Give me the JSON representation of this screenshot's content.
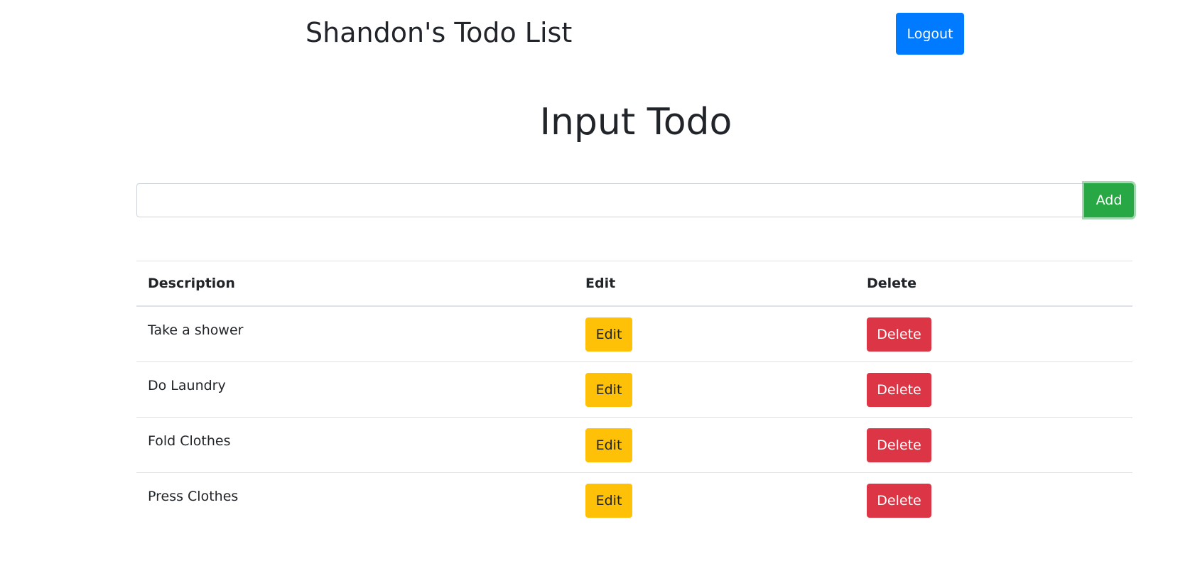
{
  "header": {
    "title": "Shandon's Todo List",
    "logout_label": "Logout"
  },
  "input_section": {
    "title": "Input Todo",
    "input_value": "",
    "add_label": "Add"
  },
  "table": {
    "headers": {
      "description": "Description",
      "edit": "Edit",
      "delete": "Delete"
    },
    "rows": [
      {
        "description": "Take a shower",
        "edit_label": "Edit",
        "delete_label": "Delete"
      },
      {
        "description": "Do Laundry",
        "edit_label": "Edit",
        "delete_label": "Delete"
      },
      {
        "description": "Fold Clothes",
        "edit_label": "Edit",
        "delete_label": "Delete"
      },
      {
        "description": "Press Clothes",
        "edit_label": "Edit",
        "delete_label": "Delete"
      }
    ]
  },
  "colors": {
    "primary": "#007bff",
    "success": "#28a745",
    "warning": "#ffc107",
    "danger": "#dc3545",
    "text": "#212529",
    "border": "#dee2e6"
  }
}
